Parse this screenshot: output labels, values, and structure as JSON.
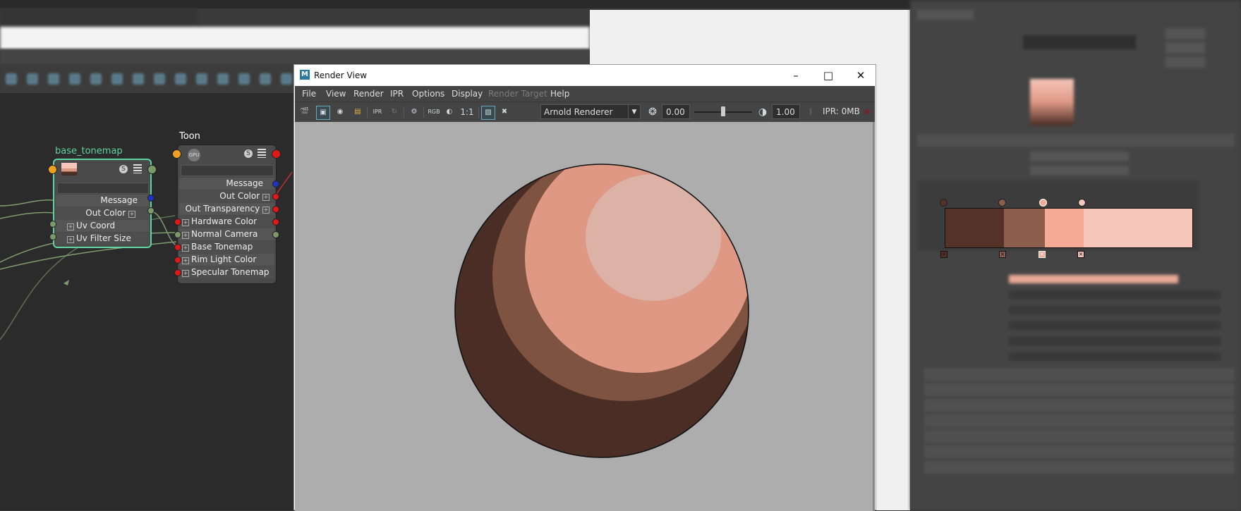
{
  "node_graph": {
    "tonemap_node": {
      "title": "base_tonemap",
      "outputs": [
        "Message",
        "Out Color"
      ],
      "inputs": [
        "Uv Coord",
        "Uv Filter Size"
      ]
    },
    "toon_node": {
      "title": "Toon",
      "outputs": [
        "Message",
        "Out Color",
        "Out Transparency"
      ],
      "inputs": [
        "Hardware Color",
        "Normal Camera",
        "Base Tonemap",
        "Rim Light Color",
        "Specular Tonemap"
      ]
    }
  },
  "render_view": {
    "window_title": "Render View",
    "app_icon": "M",
    "menu": [
      "File",
      "View",
      "Render",
      "IPR",
      "Options",
      "Display",
      "Render Target",
      "Help"
    ],
    "toolbar": {
      "rgb_label": "RGB",
      "ratio_label": "1:1",
      "renderer": "Arnold Renderer",
      "exposure": "0.00",
      "gamma": "1.00",
      "ipr_memory": "IPR: 0MB"
    }
  },
  "colors": {
    "toon_dark": "#4a2e25",
    "toon_mid": "#7e5342",
    "toon_light": "#de9884",
    "toon_highlight": "#dcb2a6",
    "ramp_1": "#543228",
    "ramp_2": "#8c5e4e",
    "ramp_3": "#f4aa94",
    "ramp_4": "#f6c6ba",
    "node_selected": "#5fd3a0"
  }
}
